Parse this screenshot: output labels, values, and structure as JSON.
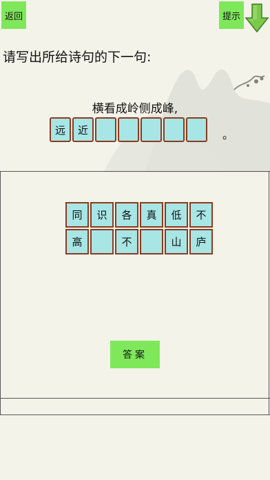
{
  "header": {
    "back_label": "返回",
    "hint_label": "提示"
  },
  "question": {
    "prompt": "请写出所给诗句的下一句:",
    "given_line": "横看成岭侧成峰,",
    "answer_slots": [
      "远",
      "近",
      "",
      "",
      "",
      "",
      ""
    ],
    "ending_punct": "。"
  },
  "choices": [
    [
      "同",
      "识",
      "各",
      "真",
      "低",
      "不"
    ],
    [
      "高",
      "",
      "不",
      "",
      "山",
      "庐"
    ]
  ],
  "answer_button_label": "答案",
  "colors": {
    "button_green": "#7ee85a",
    "tile_fill": "#a8e6e6",
    "tile_border": "#8b3a1e"
  }
}
